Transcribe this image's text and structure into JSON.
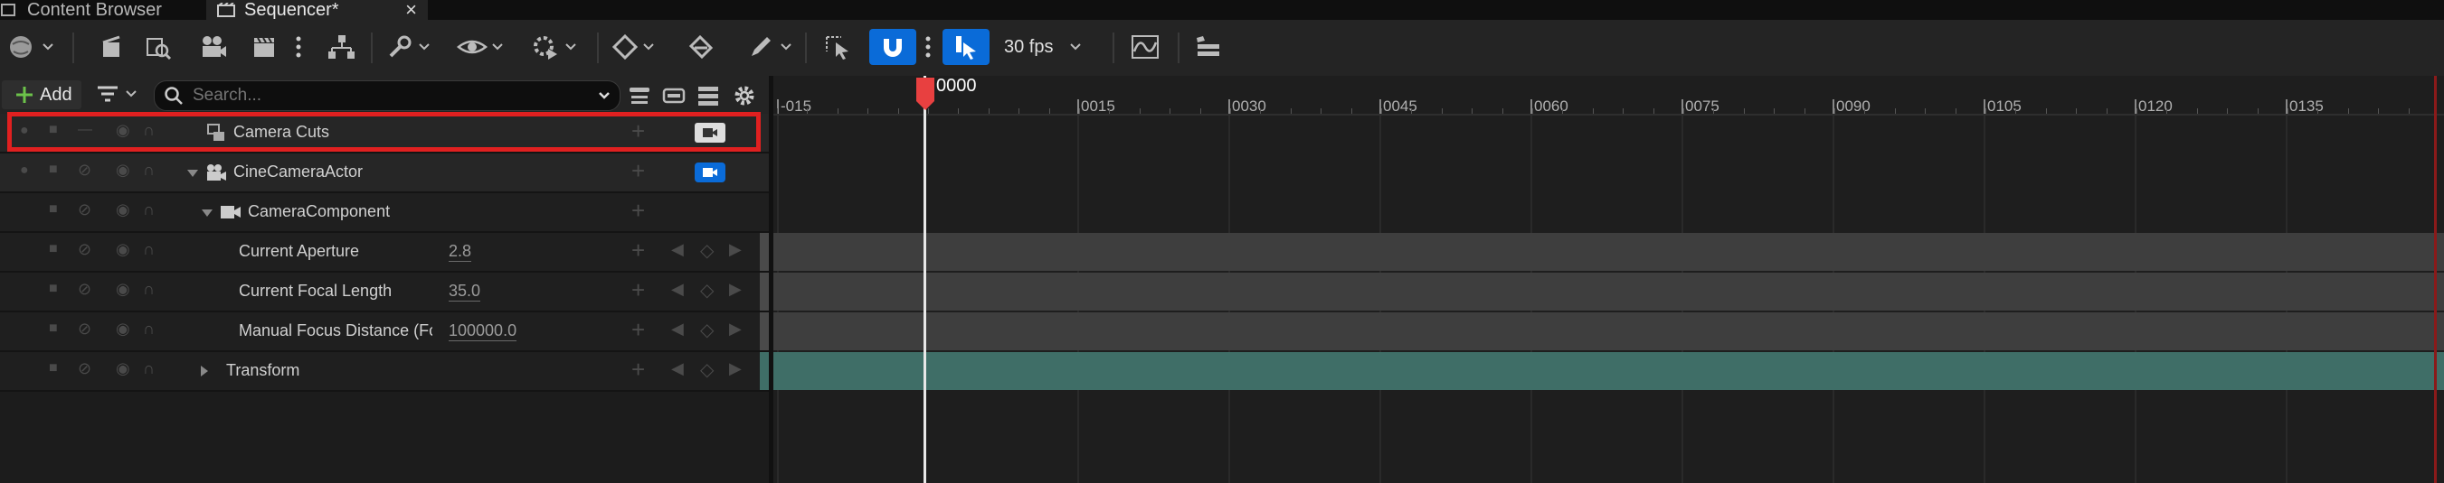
{
  "tabs": [
    {
      "label": "Content Browser",
      "active": false
    },
    {
      "label": "Sequencer*",
      "active": true,
      "close": "×"
    }
  ],
  "toolbar": {
    "fps_label": "30 fps",
    "accent": "#0a6bd8"
  },
  "outliner_header": {
    "add_label": "Add",
    "search_placeholder": "Search..."
  },
  "tracks": [
    {
      "label": "Camera Cuts",
      "selected": true
    },
    {
      "label": "CineCameraActor"
    },
    {
      "label": "CameraComponent"
    },
    {
      "label": "Current Aperture",
      "value": "2.8"
    },
    {
      "label": "Current Focal Length",
      "value": "35.0"
    },
    {
      "label": "Manual Focus Distance (Fc",
      "value": "100000.0"
    },
    {
      "label": "Transform"
    }
  ],
  "timeline": {
    "playhead_label": "0000",
    "ticks": [
      "-015",
      "0015",
      "0030",
      "0045",
      "0060",
      "0075",
      "0090",
      "0105",
      "0120",
      "0135"
    ]
  },
  "colors": {
    "highlight": "#e02020",
    "playhead": "#e84040",
    "track_bar": "#3e3e3e",
    "transform_bar": "#3f6e67"
  }
}
